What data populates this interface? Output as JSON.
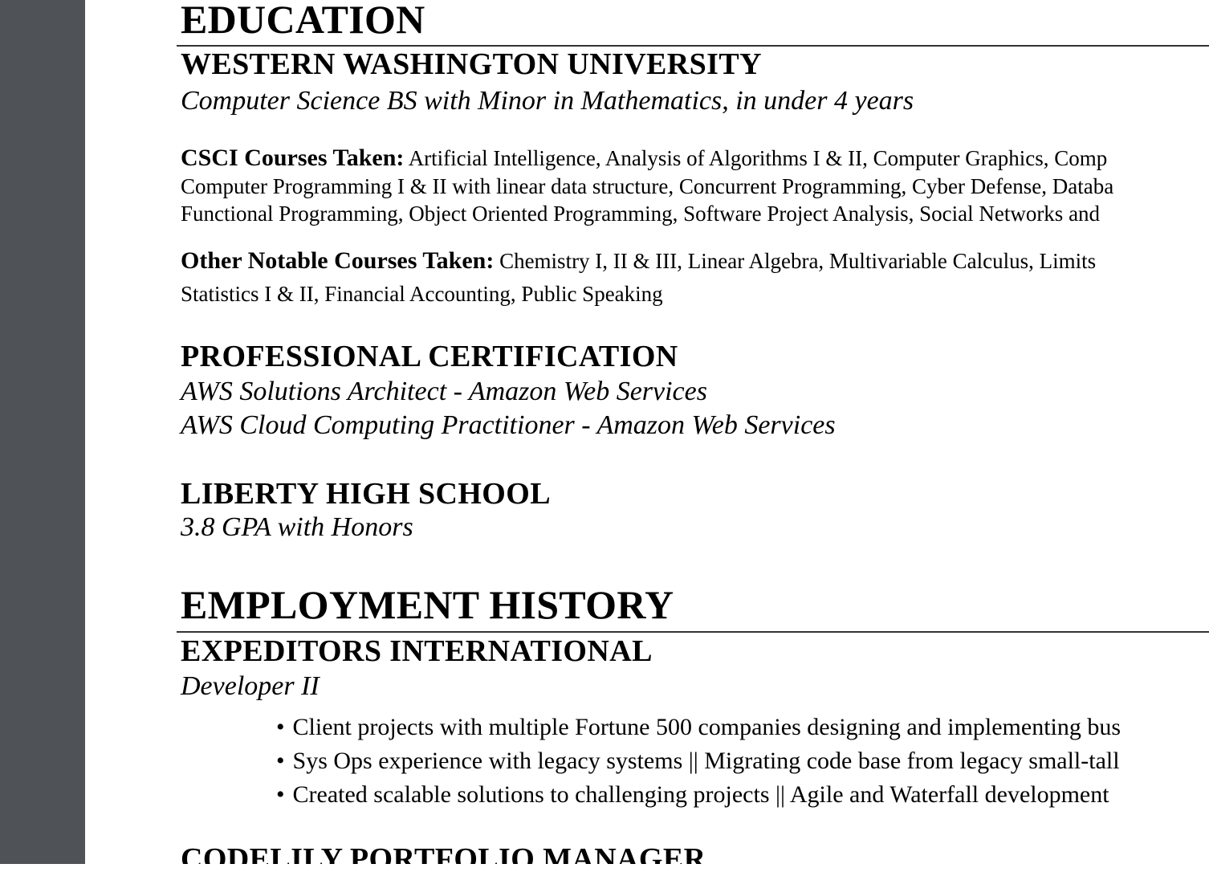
{
  "education": {
    "heading": "EDUCATION",
    "university": {
      "name": "WESTERN WASHINGTON UNIVERSITY",
      "degree": "Computer Science BS with Minor in Mathematics, in under 4 years",
      "csci_label": "CSCI Courses Taken:",
      "csci_lines": [
        "Artificial Intelligence, Analysis of Algorithms I & II, Computer Graphics, Comp",
        "Computer Programming I & II with linear data structure, Concurrent Programming, Cyber Defense, Databa",
        "Functional Programming, Object Oriented Programming, Software Project Analysis, Social Networks and"
      ],
      "other_label": "Other Notable Courses Taken:",
      "other_lines": [
        "Chemistry I, II & III, Linear Algebra, Multivariable Calculus, Limits",
        "Statistics I & II, Financial Accounting, Public Speaking"
      ]
    },
    "certification": {
      "heading": "PROFESSIONAL CERTIFICATION",
      "items": [
        "AWS Solutions Architect - Amazon Web Services",
        "AWS Cloud Computing Practitioner - Amazon Web Services"
      ]
    },
    "high_school": {
      "name": "LIBERTY HIGH SCHOOL",
      "detail": "3.8 GPA with Honors"
    }
  },
  "employment": {
    "heading": "EMPLOYMENT HISTORY",
    "jobs": [
      {
        "company": "EXPEDITORS INTERNATIONAL",
        "title": "Developer II",
        "bullets": [
          "Client projects with multiple Fortune 500 companies designing and implementing bus",
          "Sys Ops experience with legacy systems || Migrating code base from legacy small-tall",
          "Created scalable solutions to challenging projects || Agile and Waterfall development"
        ]
      }
    ],
    "next_company_partial": "CODELILY PORTFOLIO MANAGER"
  },
  "bullet_glyph": "•"
}
